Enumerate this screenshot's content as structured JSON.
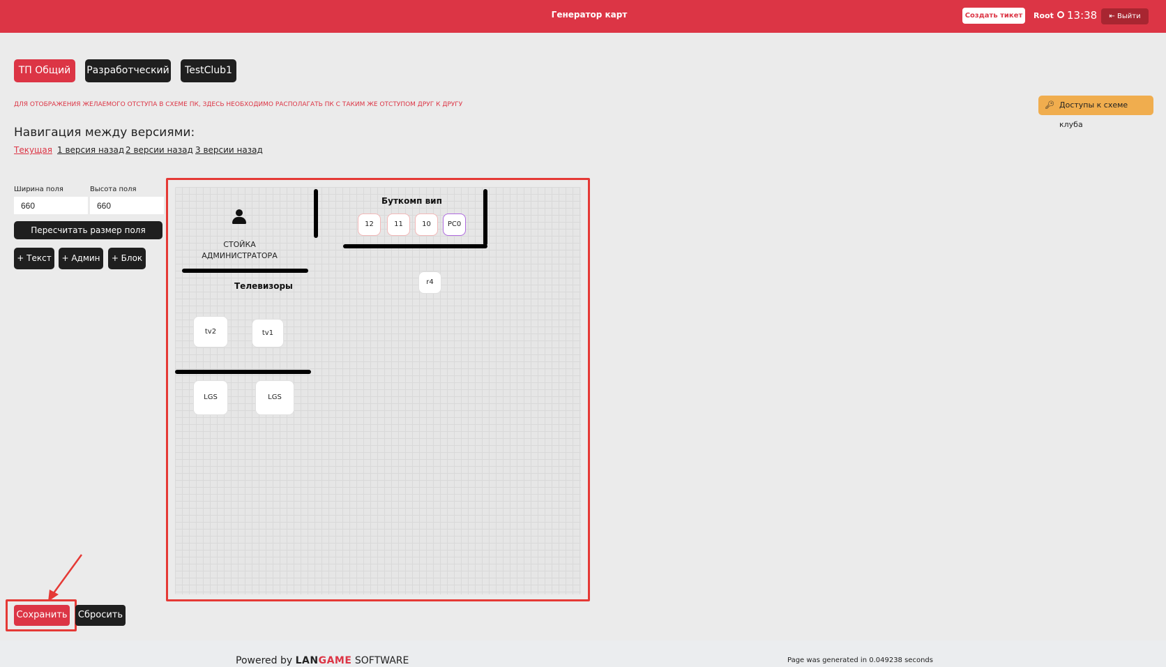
{
  "header": {
    "title": "Генератор карт",
    "create_ticket": "Создать тикет",
    "user": "Root",
    "time": "13:38",
    "logout": "Выйти"
  },
  "tabs": [
    {
      "label": "ТП Общий",
      "active": true
    },
    {
      "label": "Разработческий",
      "active": false
    },
    {
      "label": "TestClub1",
      "active": false
    }
  ],
  "warning": "ДЛЯ ОТОБРАЖЕНИЯ ЖЕЛАЕМОГО ОТСТУПА В СХЕМЕ ПК, ЗДЕСЬ НЕОБХОДИМО РАСПОЛАГАТЬ ПК С ТАКИМ ЖЕ ОТСТУПОМ ДРУГ К ДРУГУ",
  "access_button": "Доступы к схеме клуба",
  "navigation": {
    "title": "Навигация между версиями:",
    "versions": [
      "Текущая",
      "1 версия назад",
      "2 версии назад",
      "3 версии назад"
    ]
  },
  "controls": {
    "width_label": "Ширина поля",
    "width_value": "660",
    "height_label": "Высота поля",
    "height_value": "660",
    "recalc": "Пересчитать размер поля",
    "add_text": "+ Текст",
    "add_admin": "+ Админ",
    "add_block": "+ Блок"
  },
  "field": {
    "admin_label": "СТОЙКА АДМИНИСТРАТОРА",
    "group_vip": "Буткомп вип",
    "group_tv": "Телевизоры",
    "vip_pcs": [
      "12",
      "11",
      "10",
      "PC0"
    ],
    "r4": "r4",
    "tvs": [
      "tv2",
      "tv1"
    ],
    "lgs": [
      "LGS",
      "LGS"
    ]
  },
  "actions": {
    "save": "Сохранить",
    "reset": "Сбросить"
  },
  "footer": {
    "powered": "Powered by",
    "brand_a": "LAN",
    "brand_b": "GAME",
    "brand_c": "SOFTWARE",
    "generated": "Page was generated in 0.049238 seconds"
  }
}
